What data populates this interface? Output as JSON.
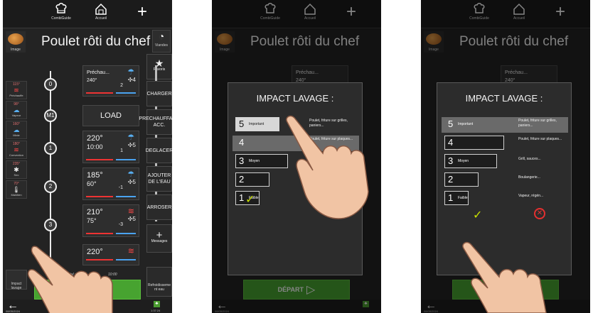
{
  "topbar": {
    "combiguide_label": "CombiGuide",
    "accueil_label": "Accueil",
    "add_symbol": "+"
  },
  "recipe": {
    "title": "Poulet rôti du chef",
    "thumb_caption": "Image"
  },
  "right_menu": {
    "viandes": "Viandes",
    "favoris": "Favoris",
    "charger": "CHARGER",
    "prechauffage": "PRECHAUFFAGE ACC.",
    "deglacer": "DEGLACER",
    "ajouter": "AJOUTER DE L'EAU",
    "arroser": "ARROSER",
    "messages": "Messages",
    "refroidissement": "Refroidisseme nt eau"
  },
  "left_modes": [
    {
      "temp": "115°",
      "label": "Préchauffe"
    },
    {
      "temp": "98°",
      "label": "Vapeur"
    },
    {
      "temp": "160°",
      "label": "Mixte"
    },
    {
      "temp": "180°",
      "label": "Convection"
    },
    {
      "temp": "235°",
      "label": "Sec"
    },
    {
      "temp": "70°",
      "label": "Maintien"
    }
  ],
  "timeline": {
    "nodes": [
      "0",
      "M1",
      "1",
      "2",
      "3"
    ]
  },
  "steps": [
    {
      "temp": "Préchau... 240°",
      "time": "",
      "fan": "4",
      "level": "2"
    },
    {
      "temp": "220°",
      "time": "10:00",
      "fan": "5",
      "level": "1"
    },
    {
      "temp": "185°",
      "time": "60°",
      "fan": "5",
      "level": "-1"
    },
    {
      "temp": "210°",
      "time": "75°",
      "fan": "5",
      "level": "-3"
    },
    {
      "temp": "220°",
      "time": "",
      "fan": "",
      "level": ""
    }
  ],
  "load_label": "LOAD",
  "impact_label": "Impact lavage",
  "total_time": {
    "label": "Temps total :",
    "value": "10:00"
  },
  "depart_label": "DÉPART",
  "bottom": {
    "date": "08/05/2024",
    "save_label": "Sauvegarder sous",
    "guide_label": "Guide",
    "time": "1:37:24"
  },
  "modal": {
    "title": "IMPACT LAVAGE :",
    "options": [
      {
        "num": "5",
        "label": "Important"
      },
      {
        "num": "4",
        "label": ""
      },
      {
        "num": "3",
        "label": "Moyen"
      },
      {
        "num": "2",
        "label": ""
      },
      {
        "num": "1",
        "label": "Faible"
      }
    ],
    "descriptions": [
      "Poulet, friture sur grilles, paniers...",
      "Poulet, friture sur plaques...",
      "Grill, sauces...",
      "Boulangerie...",
      "Vapeur, régén..."
    ]
  },
  "colors": {
    "start": "#47a330",
    "alert_red": "#ff4848",
    "steam_blue": "#58aef0",
    "ok_yellow": "#c8e000"
  }
}
